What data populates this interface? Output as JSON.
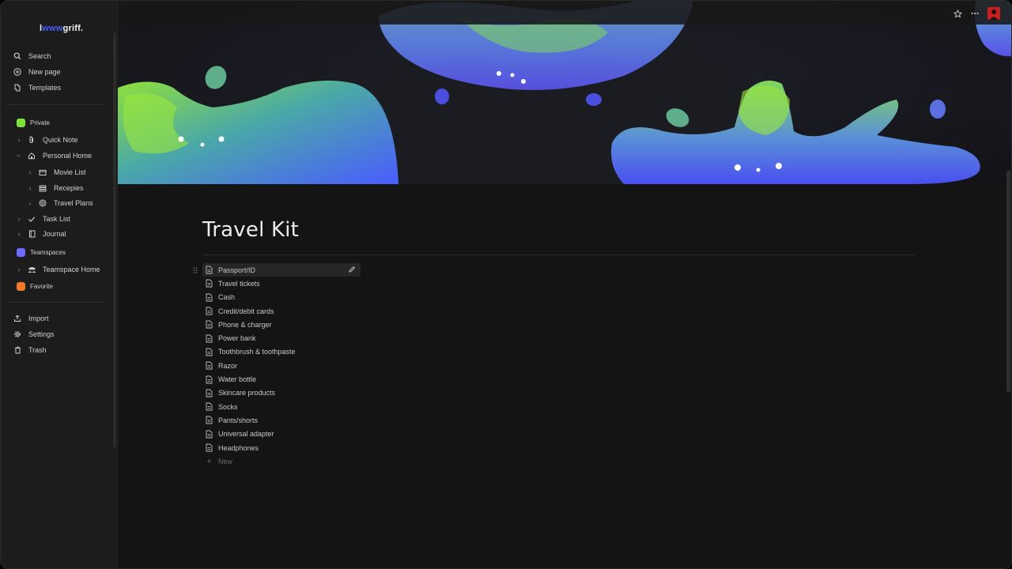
{
  "app": {
    "logo_prefix": "l",
    "logo_accent": "www",
    "logo_suffix": "griff."
  },
  "colors": {
    "accent": "#4a5cff",
    "private_section": "#7ee23b",
    "teamspaces_section": "#6e6cff",
    "favorite_section": "#f07a2a",
    "avatar": "#c62020"
  },
  "sidebar": {
    "top": [
      {
        "label": "Search",
        "icon": "search-icon"
      },
      {
        "label": "New page",
        "icon": "plus-circle-icon"
      },
      {
        "label": "Templates",
        "icon": "templates-icon"
      }
    ],
    "private_label": "Private",
    "private_items": [
      {
        "label": "Quick Note",
        "icon": "paperclip-icon"
      },
      {
        "label": "Personal Home",
        "icon": "home-icon"
      },
      {
        "label": "Movie List",
        "icon": "film-icon"
      },
      {
        "label": "Recepies",
        "icon": "stack-icon"
      },
      {
        "label": "Travel Plans",
        "icon": "target-icon"
      },
      {
        "label": "Task List",
        "icon": "checkmark-icon"
      },
      {
        "label": "Journal",
        "icon": "journal-icon"
      }
    ],
    "teamspaces_label": "Teamspaces",
    "teamspace_home": "Teamspace Home",
    "favorite_label": "Favorite",
    "bottom": [
      {
        "label": "Import",
        "icon": "import-icon"
      },
      {
        "label": "Settings",
        "icon": "gear-icon"
      },
      {
        "label": "Trash",
        "icon": "trash-icon"
      }
    ]
  },
  "page": {
    "title": "Travel Kit",
    "items": [
      "Passport/ID",
      "Travel tickets",
      "Cash",
      "Credit/debit cards",
      "Phone & charger",
      "Power bank",
      "Toothbrush & toothpaste",
      "Razor",
      "Water bottle",
      "Skincare products",
      "Socks",
      "Pants/shorts",
      "Universal adapter",
      "Headphones"
    ],
    "new_label": "New"
  }
}
